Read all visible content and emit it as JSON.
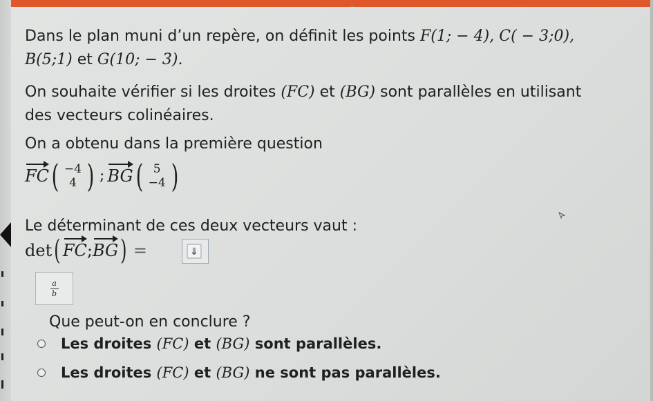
{
  "intro": {
    "line1_text": "Dans le plan muni d’un repère, on définit les points",
    "point_F": "F(1; − 4),",
    "point_C": "C( − 3;0),",
    "point_B": "B(5;1)",
    "et": "et",
    "point_G": "G(10; − 3)."
  },
  "question": {
    "line1": "On souhaite vérifier si les droites",
    "FC": "(FC)",
    "et": "et",
    "BG": "(BG)",
    "line1_end": "sont parallèles en utilisant",
    "line2": "des vecteurs colinéaires."
  },
  "first_result": {
    "label": "On a obtenu dans la première question",
    "vec_FC": "FC",
    "FC_x": "−4",
    "FC_y": "4",
    "sep": ";",
    "vec_BG": "BG",
    "BG_x": "5",
    "BG_y": "−4"
  },
  "determinant": {
    "label": "Le déterminant de ces deux vecteurs vaut :",
    "det": "det",
    "vec1": "FC",
    "sep": ";",
    "vec2": "BG",
    "equals": "=",
    "answer_value": "",
    "answer_icon": "⇓"
  },
  "fraction_button": {
    "numerator": "a",
    "denominator": "b"
  },
  "conclusion": {
    "question": "Que peut-on en conclure ?",
    "options": [
      {
        "prefix": "Les droites",
        "l1": "(FC)",
        "et": "et",
        "l2": "(BG)",
        "suffix": "sont parallèles."
      },
      {
        "prefix": "Les droites",
        "l1": "(FC)",
        "et": "et",
        "l2": "(BG)",
        "suffix": "ne sont pas parallèles."
      }
    ]
  },
  "colors": {
    "accent": "#e0582a",
    "background": "#dcdedd",
    "text": "#1f1f1f"
  }
}
